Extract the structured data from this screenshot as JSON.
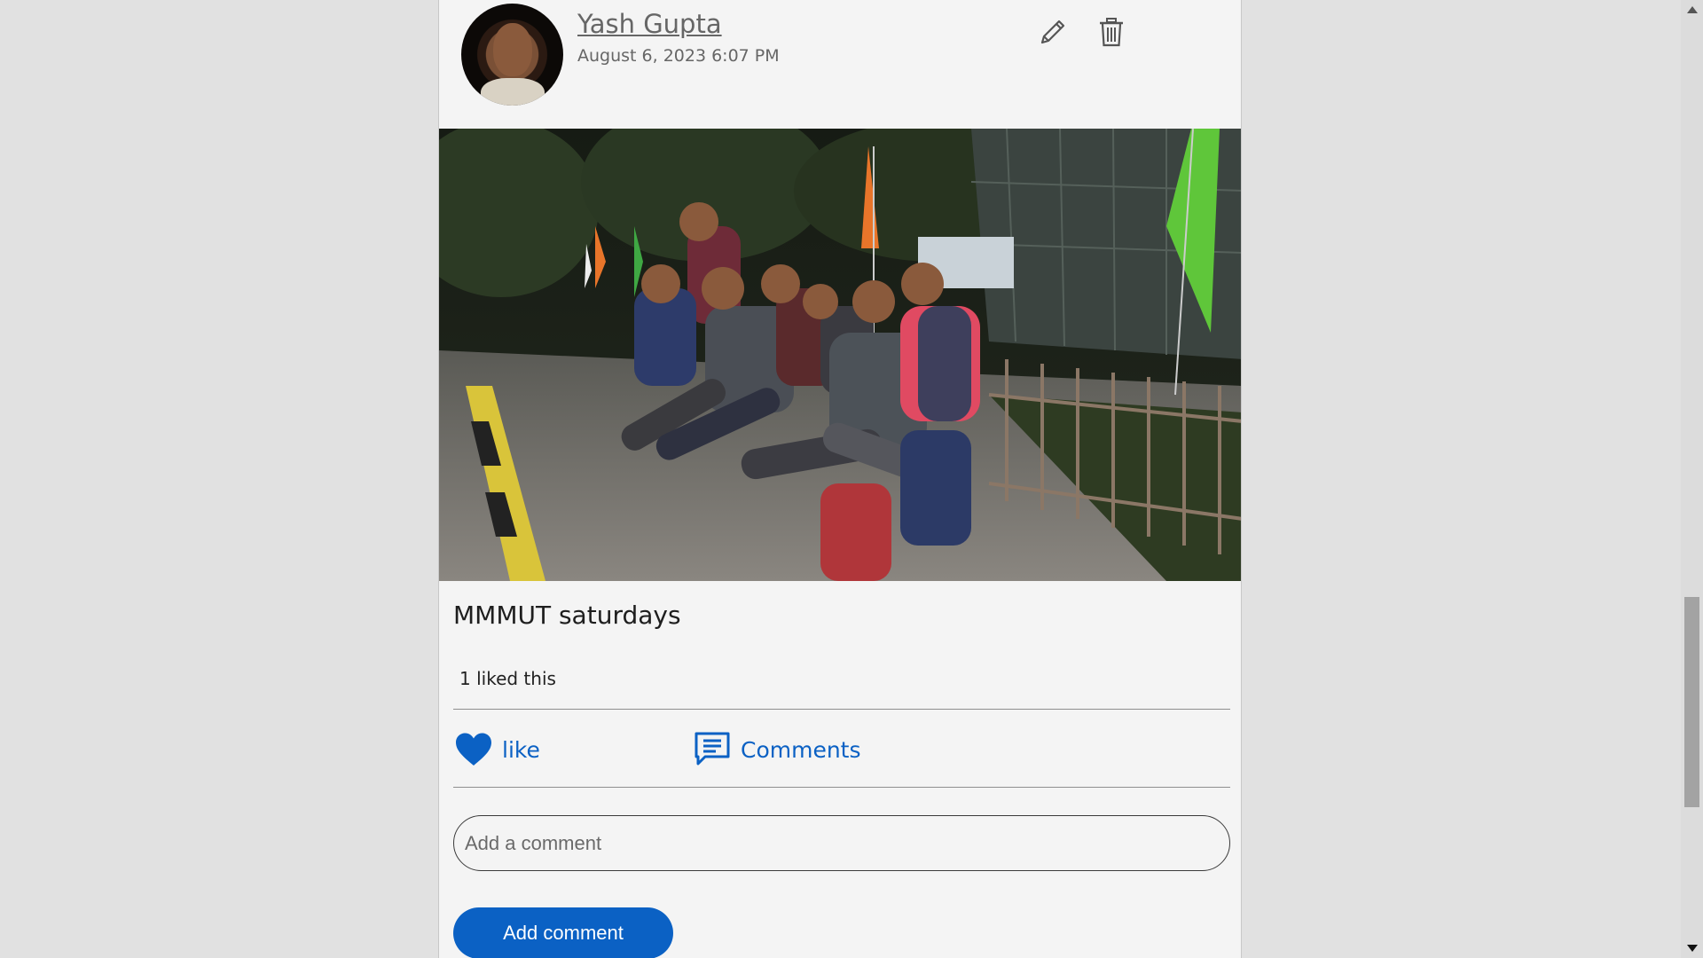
{
  "post": {
    "author_name": "Yash Gupta",
    "timestamp": "August 6, 2023 6:07 PM",
    "caption": "MMMUT saturdays",
    "likes_summary": "1 liked this",
    "actions": {
      "like_label": "like",
      "comments_label": "Comments"
    },
    "comment_input": {
      "placeholder": "Add a comment",
      "value": ""
    },
    "add_comment_label": "Add comment",
    "icons": {
      "edit": "pencil-icon",
      "delete": "trash-icon",
      "like": "heart-icon",
      "comments": "comment-icon"
    },
    "colors": {
      "accent": "#0b61c4",
      "card_bg": "#f4f4f4",
      "page_bg": "#e1e1e1"
    }
  }
}
